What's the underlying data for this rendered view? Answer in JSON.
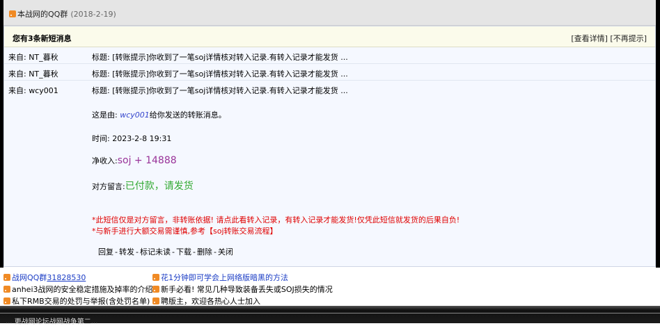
{
  "header": {
    "title": "本战网的QQ群",
    "date": "(2018-2-19)"
  },
  "notice": {
    "lead": "您有3条新短消息",
    "view_details": "[查看详情]",
    "dismiss": "[不再提示]"
  },
  "messages": [
    {
      "from": "来自: NT_暮秋",
      "subject": "标题: [转账提示]你收到了一笔soj详情核对转入记录.有转入记录才能发货 ..."
    },
    {
      "from": "来自: NT_暮秋",
      "subject": "标题: [转账提示]你收到了一笔soj详情核对转入记录.有转入记录才能发货 ..."
    },
    {
      "from": "来自: wcy001",
      "subject": "标题: [转账提示]你收到了一笔soj详情核对转入记录.有转入记录才能发货 ..."
    }
  ],
  "detail": {
    "sent_prefix": "这是由: ",
    "sender": "wcy001",
    "sent_suffix": "给你发送的转账消息。",
    "time": "时间: 2023-2-8 19:31",
    "amount_label": "净收入:",
    "amount_value": "soj + 14888",
    "message_label": "对方留言:",
    "message_value": "已付款，请发货",
    "warning1": "*此短信仅是对方留言，非转账依据! 请点此看转入记录，有转入记录才能发货!仅凭此短信就发货的后果自负!",
    "warning2": "*与新手进行大额交易需谨慎,参考【soj转账交易流程】"
  },
  "actions": {
    "reply": "回复",
    "forward": "转发",
    "mark_unread": "标记未读",
    "download": "下载",
    "delete": "删除",
    "close": "关闭",
    "sep": "-"
  },
  "footer": {
    "qq_group_label": "战网QQ群",
    "qq_group_number": "31828530",
    "tip1": "花1分钟即可学会上网络版暗黑的方法",
    "tip2": "anhei3战网的安全稳定措施及掉率的介绍",
    "tip3": "新手必看! 常见几种导致装备丢失或SOJ损失的情况",
    "tip4": "私下RMB交易的处罚与举报(含处罚名单)",
    "tip5": "聘版主，欢迎各热心人士加入"
  },
  "bottom": {
    "text": "... 更战网论坛战网战争第二..."
  }
}
